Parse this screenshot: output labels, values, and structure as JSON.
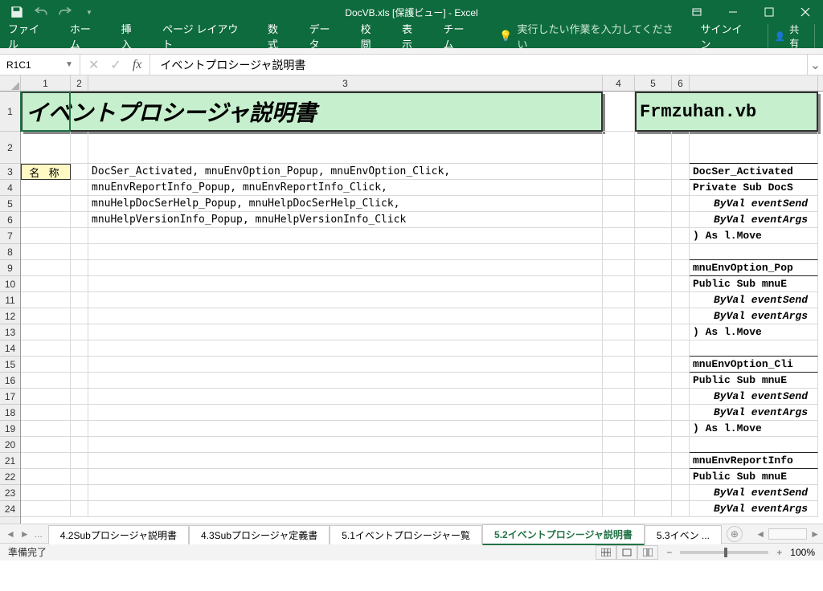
{
  "titlebar": {
    "document_title": "DocVB.xls  [保護ビュー] - Excel"
  },
  "ribbon": {
    "tabs": [
      "ファイル",
      "ホーム",
      "挿入",
      "ページ レイアウト",
      "数式",
      "データ",
      "校閲",
      "表示",
      "チーム"
    ],
    "tell_me": "実行したい作業を入力してください",
    "signin": "サインイン",
    "share": "共有"
  },
  "formula_bar": {
    "name_box": "R1C1",
    "formula": "イベントプロシージャ説明書"
  },
  "columns": [
    "1",
    "2",
    "3",
    "4",
    "5",
    "6"
  ],
  "rows": [
    "1",
    "2",
    "3",
    "4",
    "5",
    "6",
    "7",
    "8",
    "9",
    "10",
    "11",
    "12",
    "13",
    "14",
    "15",
    "16",
    "17",
    "18",
    "19",
    "20",
    "21",
    "22",
    "23",
    "24"
  ],
  "sheet": {
    "title_main": "イベントプロシージャ説明書",
    "title_file": "Frmzuhan.vb",
    "label_name": "名 称",
    "lines": [
      "DocSer_Activated, mnuEnvOption_Popup, mnuEnvOption_Click,",
      "mnuEnvReportInfo_Popup, mnuEnvReportInfo_Click,",
      "mnuHelpDocSerHelp_Popup, mnuHelpDocSerHelp_Click,",
      "mnuHelpVersionInfo_Popup, mnuHelpVersionInfo_Click"
    ],
    "right_code": [
      "DocSer_Activated",
      "Private Sub DocS",
      "ByVal eventSend",
      "ByVal eventArgs",
      ") As l.Move",
      "",
      "mnuEnvOption_Pop",
      "Public Sub mnuE",
      "ByVal eventSend",
      "ByVal eventArgs",
      ") As l.Move",
      "",
      "mnuEnvOption_Cli",
      "Public Sub mnuE",
      "ByVal eventSend",
      "ByVal eventArgs",
      ") As l.Move",
      "",
      "mnuEnvReportInfo",
      "Public Sub mnuE",
      "ByVal eventSend",
      "ByVal eventArgs"
    ]
  },
  "sheet_tabs": {
    "tabs": [
      "4.2Subプロシージャ説明書",
      "4.3Subプロシージャ定義書",
      "5.1イベントプロシージャー覧",
      "5.2イベントプロシージャ説明書",
      "5.3イベン"
    ],
    "active_index": 3,
    "more": "..."
  },
  "status_bar": {
    "status": "準備完了",
    "zoom": "100%"
  }
}
